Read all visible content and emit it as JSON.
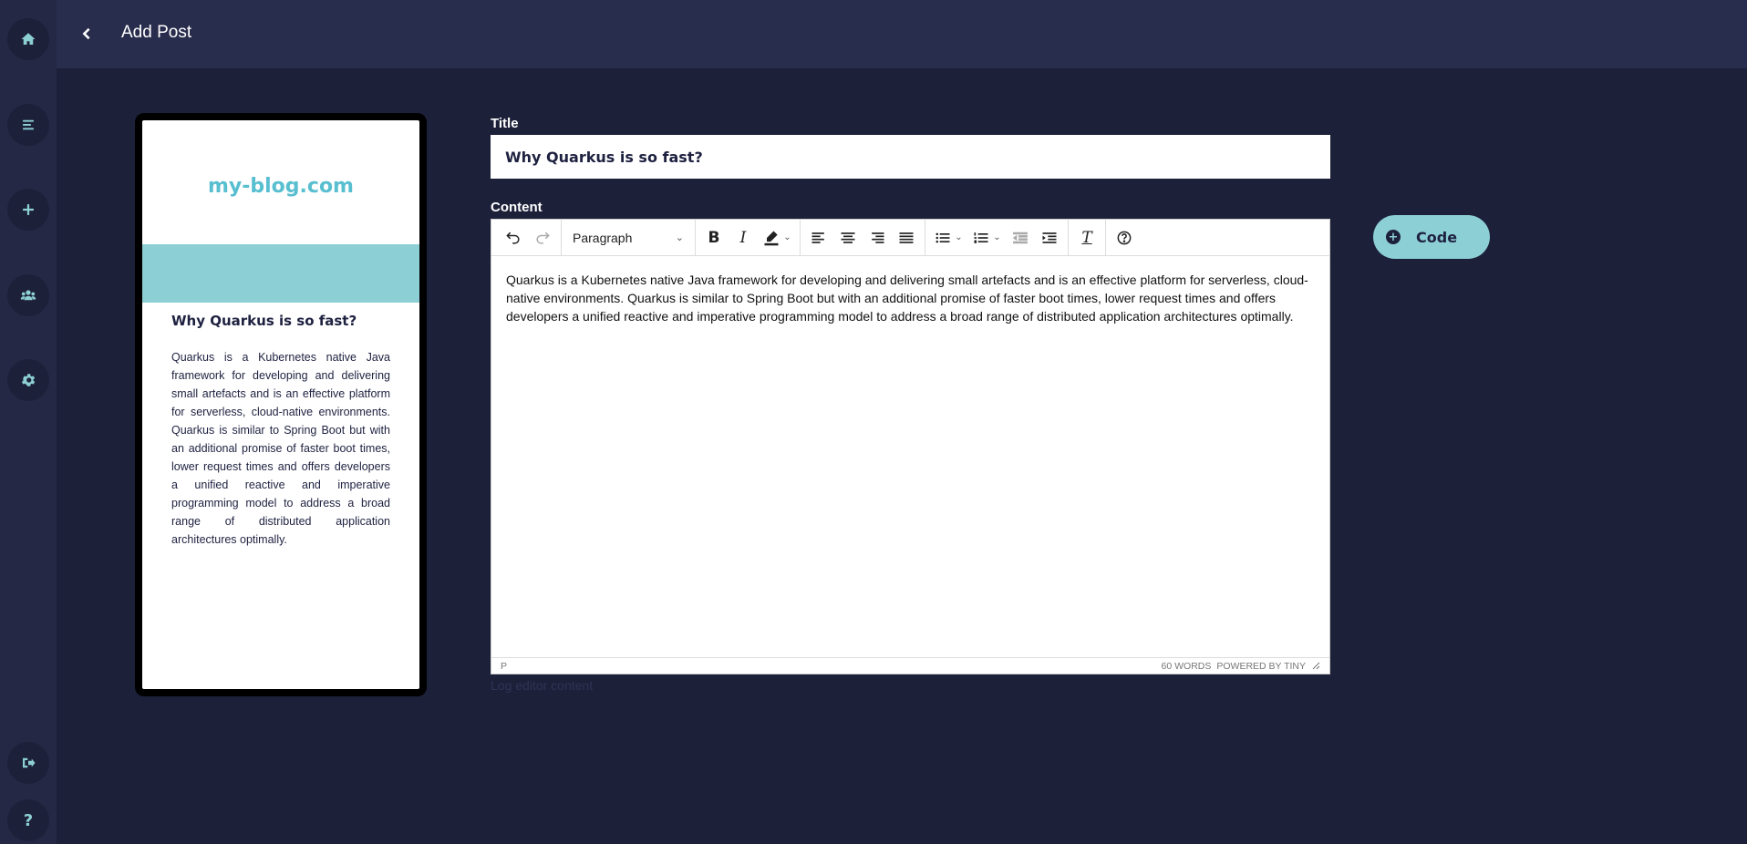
{
  "header": {
    "title": "Add Post",
    "back_icon": "chevron-left-icon"
  },
  "sidebar": {
    "top_items": [
      {
        "icon": "home-icon",
        "label": "Home"
      },
      {
        "icon": "list-icon",
        "label": "Posts"
      },
      {
        "icon": "plus-icon",
        "label": "Add"
      },
      {
        "icon": "users-icon",
        "label": "Users"
      },
      {
        "icon": "gear-icon",
        "label": "Settings"
      }
    ],
    "bottom_items": [
      {
        "icon": "logout-icon",
        "label": "Logout"
      },
      {
        "icon": "help-icon",
        "label": "?"
      }
    ]
  },
  "preview": {
    "site_name": "my-blog.com",
    "post_title": "Why Quarkus is so fast?",
    "post_body": "Quarkus is a Kubernetes native Java framework for developing and delivering small artefacts and is an effective platform for serverless, cloud-native environments. Quarkus is similar to Spring Boot but with an additional promise of faster boot times, lower request times and offers developers a unified reactive and imperative programming model to address a broad range of distributed application architectures optimally."
  },
  "form": {
    "title_label": "Title",
    "title_value": "Why Quarkus is so fast?",
    "content_label": "Content",
    "block_format": "Paragraph",
    "content_text": "Quarkus is a Kubernetes native Java framework for developing and delivering small artefacts and is an effective platform for serverless, cloud-native environments. Quarkus is similar to Spring Boot but with an additional promise of faster boot times, lower request times and offers developers a unified reactive and imperative programming model to address a broad range of distributed application architectures optimally.",
    "status_path": "P",
    "word_count": "60 WORDS",
    "powered_by": "POWERED BY TINY",
    "log_text": "Log editor content"
  },
  "code_button": {
    "label": "Code"
  },
  "colors": {
    "accent": "#8ccfd4",
    "background": "#1d2039",
    "header": "#292d4d",
    "sidebar": "#242845"
  }
}
